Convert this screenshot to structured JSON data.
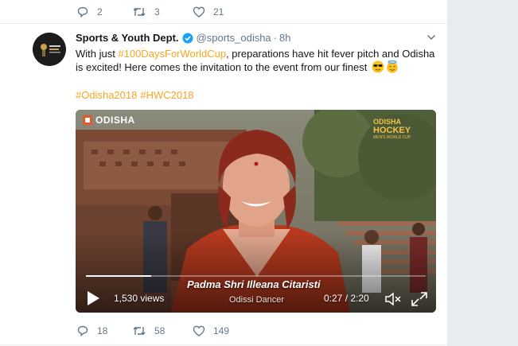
{
  "previous_tweet": {
    "reply_count": "2",
    "retweet_count": "3",
    "like_count": "21"
  },
  "tweet": {
    "author_name": "Sports & Youth Dept.",
    "handle": "@sports_odisha",
    "separator": "·",
    "time": "8h",
    "text_before": "With just ",
    "hashtag_inline": "#100DaysForWorldCup",
    "text_after": ", preparations have hit fever pitch and Odisha is excited! Here comes the invitation to the event from our finest",
    "hashtags": [
      "#Odisha2018",
      "#HWC2018"
    ],
    "avatar_logo_text": "ODISHA HOCKEY",
    "reply_count": "18",
    "retweet_count": "58",
    "like_count": "149"
  },
  "video": {
    "logo_left": "ODISHA",
    "logo_right_line1": "ODISHA",
    "logo_right_line2": "HOCKEY",
    "logo_right_line3": "MEN'S WORLD CUP",
    "caption_name": "Padma Shri Illeana Citaristi",
    "caption_role": "Odissi Dancer",
    "views": "1,530 views",
    "timecode": "0:27 / 2:20",
    "progress_fraction": 0.193
  },
  "colors": {
    "hashtag": "#f5a623",
    "verified": "#1da1f2",
    "muted_text": "#657786",
    "divider": "#e6ecf0"
  },
  "icons": {
    "reply": "reply-icon",
    "retweet": "retweet-icon",
    "like": "like-icon",
    "verified": "verified-badge-icon",
    "caret": "chevron-down-icon",
    "play": "play-icon",
    "mute": "volume-muted-icon",
    "fullscreen": "fullscreen-icon"
  }
}
